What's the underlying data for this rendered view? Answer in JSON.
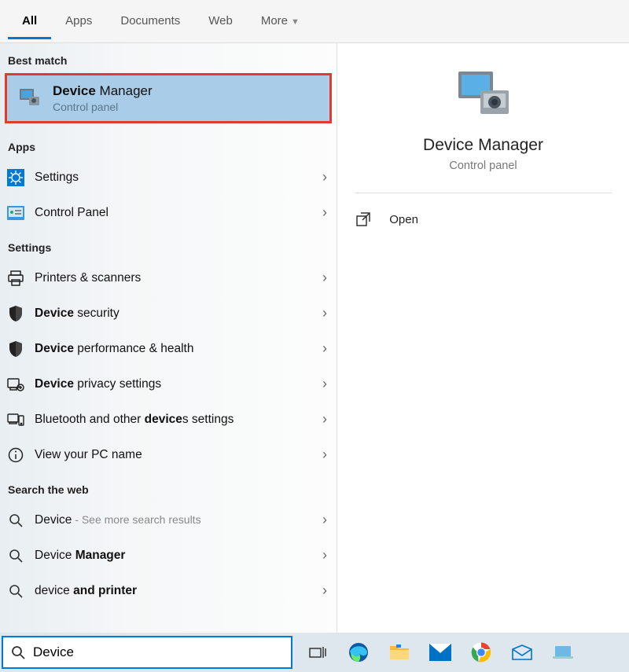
{
  "tabs": [
    {
      "label": "All",
      "active": true
    },
    {
      "label": "Apps",
      "active": false
    },
    {
      "label": "Documents",
      "active": false
    },
    {
      "label": "Web",
      "active": false
    },
    {
      "label": "More",
      "active": false,
      "dropdown": true
    }
  ],
  "sections": {
    "best_match_label": "Best match",
    "apps_label": "Apps",
    "settings_label": "Settings",
    "web_label": "Search the web"
  },
  "best_match": {
    "title_bold": "Device",
    "title_rest": " Manager",
    "subtitle": "Control panel"
  },
  "apps_items": [
    {
      "label_plain": "Settings",
      "icon": "settings-gear"
    },
    {
      "label_plain": "Control Panel",
      "icon": "control-panel"
    }
  ],
  "settings_items": [
    {
      "pre": "Printers & scanners",
      "bold": "",
      "post": "",
      "icon": "printer"
    },
    {
      "pre": "",
      "bold": "Device",
      "post": " security",
      "icon": "shield"
    },
    {
      "pre": "",
      "bold": "Device",
      "post": " performance & health",
      "icon": "shield"
    },
    {
      "pre": "",
      "bold": "Device",
      "post": " privacy settings",
      "icon": "privacy"
    },
    {
      "pre": "Bluetooth and other ",
      "bold": "device",
      "post": "s settings",
      "icon": "bluetooth-dev"
    },
    {
      "pre": "View your PC name",
      "bold": "",
      "post": "",
      "icon": "info"
    }
  ],
  "web_items": [
    {
      "pre": "Device",
      "bold": "",
      "post": "",
      "hint": " - See more search results"
    },
    {
      "pre": "Device ",
      "bold": "Manager",
      "post": ""
    },
    {
      "pre": "device ",
      "bold": "and printer",
      "post": ""
    }
  ],
  "preview": {
    "title": "Device Manager",
    "subtitle": "Control panel",
    "open_label": "Open"
  },
  "search": {
    "value": "Device"
  },
  "colors": {
    "accent": "#0078d4",
    "highlight": "#e23b2e",
    "selection": "#a9cce8"
  }
}
